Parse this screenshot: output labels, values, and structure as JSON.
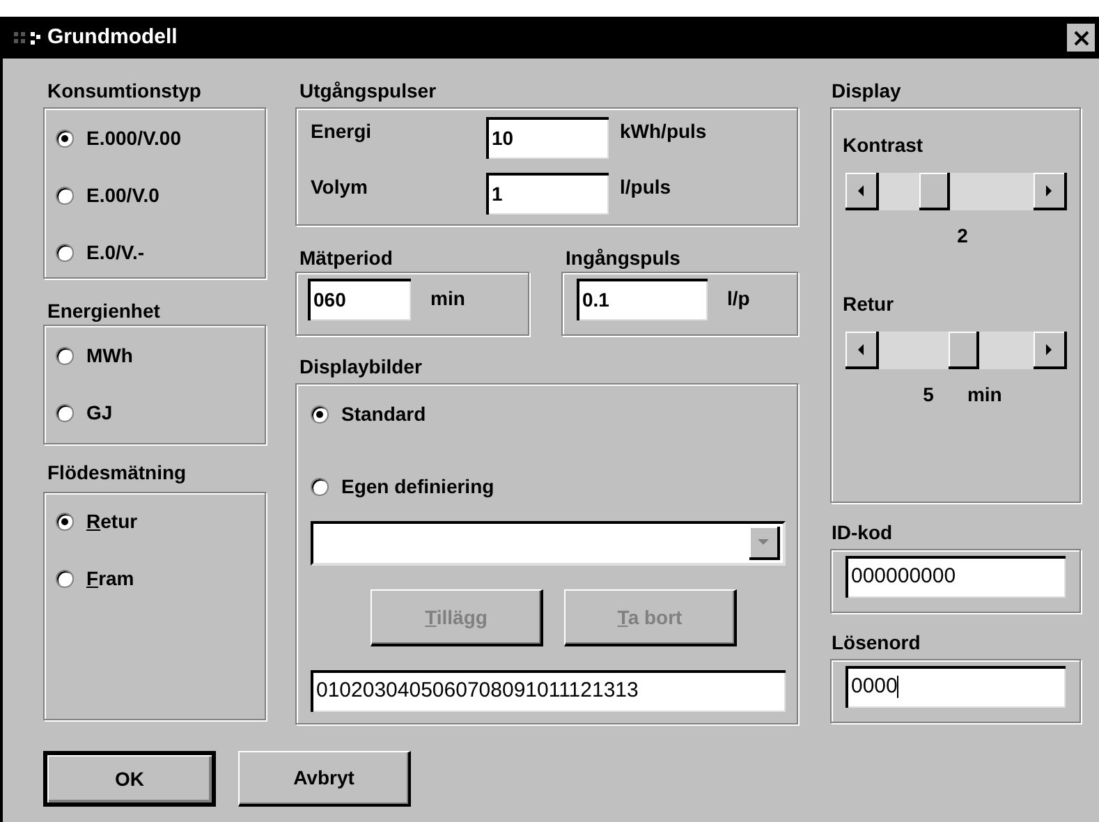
{
  "window": {
    "title": "Grundmodell"
  },
  "konsumtionstyp": {
    "label": "Konsumtionstyp",
    "options": [
      {
        "label": "E.000/V.00",
        "selected": true,
        "underline_first": false
      },
      {
        "label": "E.00/V.0",
        "selected": false,
        "underline_first": false
      },
      {
        "label": "E.0/V.-",
        "selected": false,
        "underline_first": false
      }
    ]
  },
  "energienhet": {
    "label": "Energienhet",
    "options": [
      {
        "label": "MWh",
        "selected": false,
        "underline_first": false
      },
      {
        "label": "GJ",
        "selected": false,
        "underline_first": false
      }
    ]
  },
  "flodesmatning": {
    "label": "Flödesmätning",
    "options": [
      {
        "label": "Retur",
        "selected": true,
        "underline_first": true
      },
      {
        "label": "Fram",
        "selected": false,
        "underline_first": true
      }
    ]
  },
  "utgangspulser": {
    "label": "Utgångspulser",
    "rows": [
      {
        "label": "Energi",
        "value": "10",
        "unit": "kWh/puls"
      },
      {
        "label": "Volym",
        "value": "1",
        "unit": "l/puls"
      }
    ]
  },
  "matperiod": {
    "label": "Mätperiod",
    "value": "060",
    "unit": "min"
  },
  "ingangspuls": {
    "label": "Ingångspuls",
    "value": "0.1",
    "unit": "l/p"
  },
  "displaybilder": {
    "label": "Displaybilder",
    "options": [
      {
        "label": "Standard",
        "selected": true,
        "underline_first": false
      },
      {
        "label": "Egen definiering",
        "selected": false,
        "underline_first": false
      }
    ],
    "buttons": [
      {
        "label": "Tillägg",
        "disabled": true,
        "underline_first": true
      },
      {
        "label": "Ta bort",
        "disabled": true,
        "underline_first": true
      }
    ],
    "sequence": "0102030405060708091011121313"
  },
  "display": {
    "label": "Display",
    "sliders": [
      {
        "label": "Kontrast",
        "level": 0.33,
        "reading": "2"
      },
      {
        "label": "Retur",
        "level": 0.56,
        "reading": "5",
        "unit": "min"
      }
    ]
  },
  "id_kod": {
    "label": "ID-kod",
    "value": "000000000"
  },
  "losenord": {
    "label": "Lösenord",
    "value": "0000"
  },
  "buttons": [
    {
      "label": "OK",
      "default": true
    },
    {
      "label": "Avbryt",
      "default": false
    }
  ]
}
